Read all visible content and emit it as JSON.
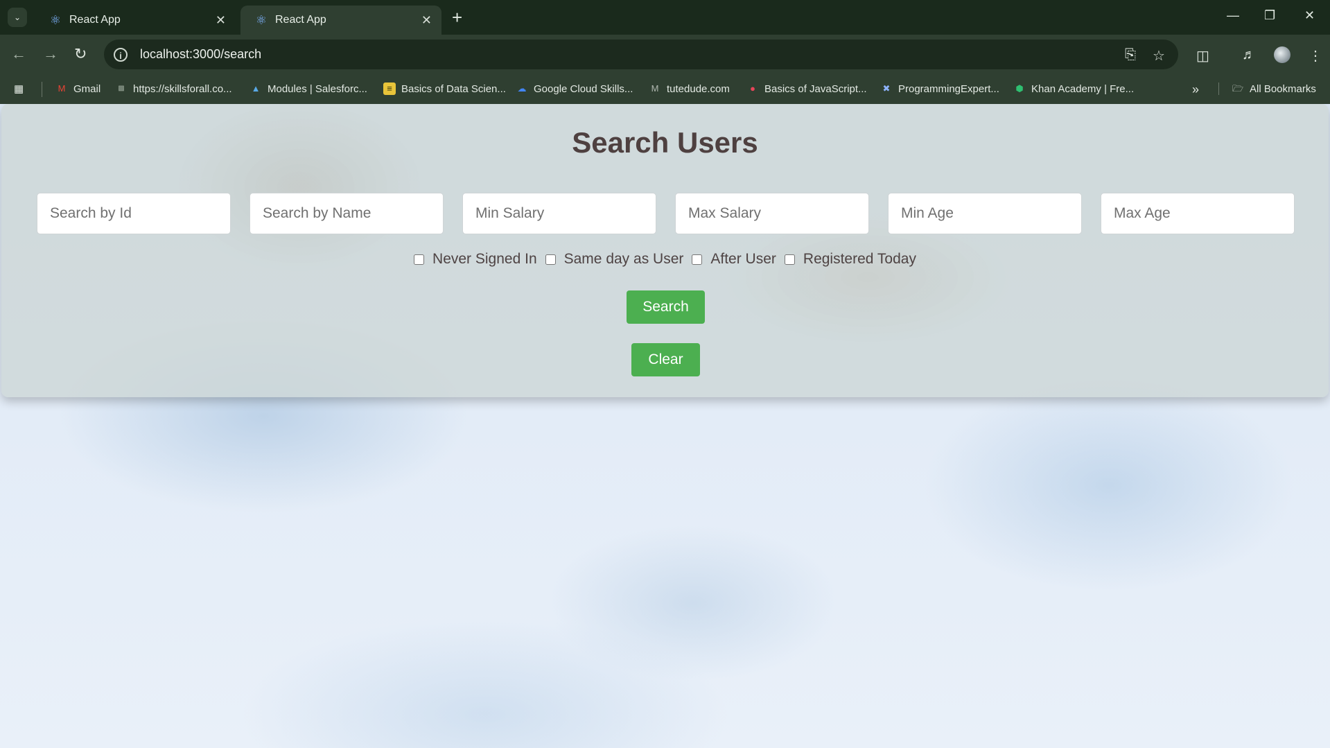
{
  "browser": {
    "tabs": [
      {
        "title": "React App",
        "active": false
      },
      {
        "title": "React App",
        "active": true
      }
    ],
    "url": "localhost:3000/search",
    "bookmarks": [
      {
        "label": "Gmail",
        "icon": "gmail-icon"
      },
      {
        "label": "https://skillsforall.co...",
        "icon": "skillsforall-icon"
      },
      {
        "label": "Modules | Salesforc...",
        "icon": "trailhead-icon"
      },
      {
        "label": "Basics of Data Scien...",
        "icon": "data-science-icon"
      },
      {
        "label": "Google Cloud Skills...",
        "icon": "google-cloud-icon"
      },
      {
        "label": "tutedude.com",
        "icon": "tutedude-icon"
      },
      {
        "label": "Basics of JavaScript...",
        "icon": "javascript-course-icon"
      },
      {
        "label": "ProgrammingExpert...",
        "icon": "programmingexpert-icon"
      },
      {
        "label": "Khan Academy | Fre...",
        "icon": "khan-academy-icon"
      }
    ],
    "all_bookmarks_label": "All Bookmarks"
  },
  "page": {
    "heading": "Search Users",
    "fields": [
      {
        "placeholder": "Search by Id",
        "value": ""
      },
      {
        "placeholder": "Search by Name",
        "value": ""
      },
      {
        "placeholder": "Min Salary",
        "value": ""
      },
      {
        "placeholder": "Max Salary",
        "value": ""
      },
      {
        "placeholder": "Min Age",
        "value": ""
      },
      {
        "placeholder": "Max Age",
        "value": ""
      }
    ],
    "checkboxes": [
      {
        "label": "Never Signed In",
        "checked": false
      },
      {
        "label": "Same day as User",
        "checked": false
      },
      {
        "label": "After User",
        "checked": false
      },
      {
        "label": "Registered Today",
        "checked": false
      }
    ],
    "search_button": "Search",
    "clear_button": "Clear"
  },
  "colors": {
    "button_green": "#4caf50",
    "heading_color": "#4e4040",
    "browser_frame": "#2f3f31"
  }
}
